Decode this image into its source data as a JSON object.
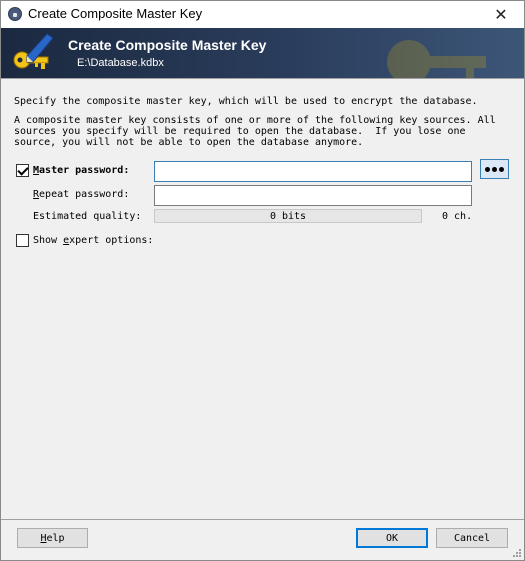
{
  "window": {
    "title": "Create Composite Master Key",
    "close_glyph": "✕",
    "icon": "lock-icon"
  },
  "banner": {
    "title": "Create Composite Master Key",
    "subtitle": "E:\\Database.kdbx",
    "icon": "key-pen-icon"
  },
  "intro": {
    "line1": "Specify the composite master key, which will be used to encrypt the database.",
    "line2": "A composite master key consists of one or more of the following key sources. All",
    "line3": "sources you specify will be required to open the database.  If you lose one",
    "line4": "source, you will not be able to open the database anymore."
  },
  "master_password": {
    "label_first": "M",
    "label_rest": "aster password:",
    "checked": true,
    "value": "",
    "toggle_icon": "show-hide-dots-icon"
  },
  "repeat_password": {
    "label_first": "R",
    "label_rest": "epeat password:",
    "value": ""
  },
  "quality": {
    "label": "Estimated quality:",
    "bits_text": "0 bits",
    "chars_text": "0 ch.",
    "level": 0
  },
  "expert": {
    "label_pre": "Show ",
    "label_ul": "e",
    "label_post": "xpert options:",
    "checked": false
  },
  "buttons": {
    "help_ul": "H",
    "help_rest": "elp",
    "ok": "OK",
    "cancel": "Cancel"
  },
  "colors": {
    "banner_dark": "#1b2940",
    "accent": "#0078d7",
    "key_gold": "#e8b800"
  }
}
